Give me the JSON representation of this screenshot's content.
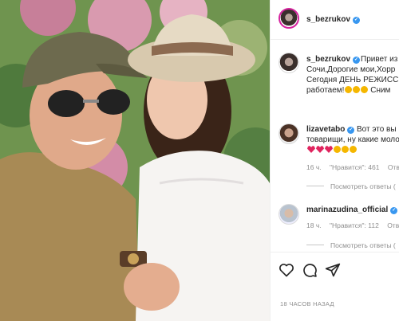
{
  "post": {
    "author": "s_bezrukov",
    "caption_lines": [
      "Привет из",
      "Сочи,Дорогие мои,Хорр",
      "Сегодня ДЕНЬ РЕЖИССЁ",
      "работаем!",
      "Сним"
    ]
  },
  "comments": [
    {
      "author": "lizavetabo",
      "lines": [
        "Вот это вы ,",
        "товарищи, ну какие моло"
      ],
      "time": "16 ч.",
      "likes": "\"Нравится\": 461",
      "reply": "Отв",
      "view_replies": "Посмотреть ответы (",
      "emoji": [
        "heart",
        "heart",
        "heart",
        "bicep",
        "bicep",
        "bicep"
      ]
    },
    {
      "author": "marinazudina_official",
      "lines": [],
      "time": "18 ч.",
      "likes": "\"Нравится\": 112",
      "reply": "Отв",
      "view_replies": "Посмотреть ответы (",
      "emoji": []
    }
  ],
  "footer": {
    "posted_ago": "18 ЧАСОВ НАЗАД",
    "icons": [
      "heart-icon",
      "comment-icon",
      "share-icon"
    ]
  },
  "colors": {
    "verified": "#3897f0",
    "text": "#262626",
    "muted": "#8e8e8e"
  }
}
